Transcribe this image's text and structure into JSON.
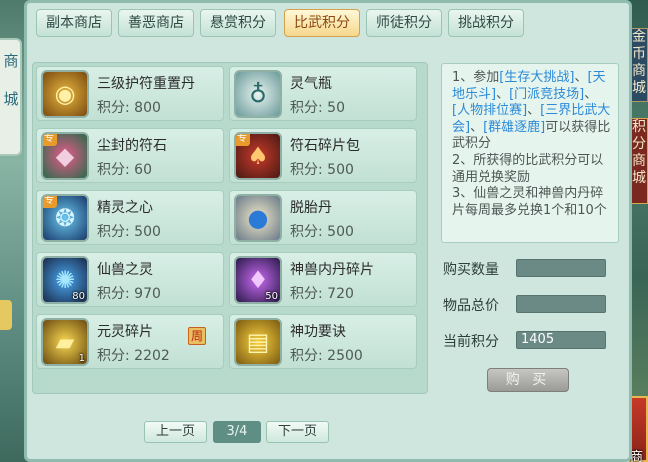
{
  "tabs": [
    "副本商店",
    "善恶商店",
    "悬赏积分",
    "比武积分",
    "师徒积分",
    "挑战积分"
  ],
  "active_tab": "比武积分",
  "items": [
    {
      "name": "三级护符重置丹",
      "price": "积分: 800",
      "icon": "amulet-pill-icon"
    },
    {
      "name": "灵气瓶",
      "price": "积分: 50",
      "icon": "spirit-bottle-icon"
    },
    {
      "name": "尘封的符石",
      "price": "积分: 60",
      "icon": "dusty-rune-stone-icon",
      "badge": "专"
    },
    {
      "name": "符石碎片包",
      "price": "积分: 500",
      "icon": "rune-fragment-bag-icon",
      "badge": "专"
    },
    {
      "name": "精灵之心",
      "price": "积分: 500",
      "icon": "elf-heart-icon",
      "badge": "专"
    },
    {
      "name": "脱胎丹",
      "price": "积分: 500",
      "icon": "rebirth-pill-icon"
    },
    {
      "name": "仙兽之灵",
      "price": "积分: 970",
      "icon": "beast-spirit-icon",
      "count": "80"
    },
    {
      "name": "神兽内丹碎片",
      "price": "积分: 720",
      "icon": "divine-beast-core-icon",
      "count": "50"
    },
    {
      "name": "元灵碎片",
      "price": "积分: 2202",
      "icon": "yuanling-fragment-icon",
      "count": "1"
    },
    {
      "name": "神功要诀",
      "price": "积分: 2500",
      "icon": "skill-manual-icon"
    }
  ],
  "week_badge": "周",
  "pagination": {
    "prev": "上一页",
    "page": "3/4",
    "next": "下一页"
  },
  "description": {
    "line1_prefix": "1、参加",
    "links": [
      "[生存大挑战]",
      "[天地乐斗]",
      "[门派竞技场]",
      "[人物排位赛]",
      "[三界比武大会]",
      "[群雄逐鹿]"
    ],
    "line1_suffix": "可以获得比武积分",
    "line2": "2、所获得的比武积分可以通用兑换奖励",
    "line3": "3、仙兽之灵和神兽内丹碎片每周最多兑换1个和10个"
  },
  "form": {
    "quantity_label": "购买数量",
    "quantity_value": "",
    "total_label": "物品总价",
    "total_value": "",
    "current_label": "当前积分",
    "current_value": "1405"
  },
  "buy_label": "购 买",
  "side": {
    "left_banner": [
      "商",
      "城"
    ],
    "right_sign1": [
      "金",
      "币",
      "商",
      "城"
    ],
    "right_sign2": [
      "积",
      "分",
      "商",
      "城"
    ],
    "right_house_label": "外观商"
  },
  "colors": {
    "link": "#2a8ad8",
    "active_tab": "#f6d78c",
    "panel": "#cfe6de"
  }
}
